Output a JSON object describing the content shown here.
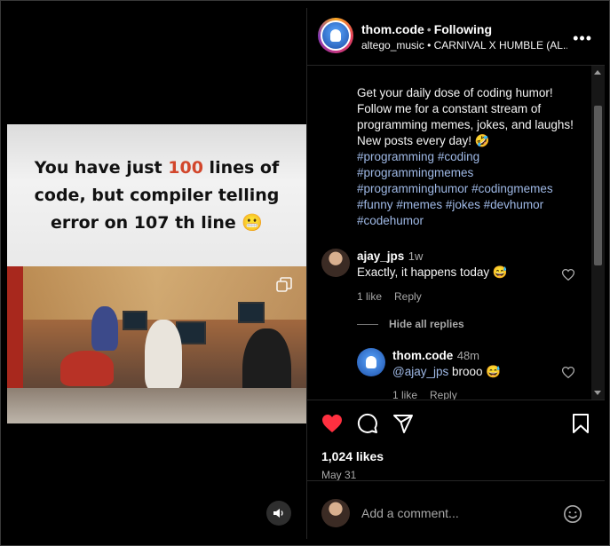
{
  "media": {
    "meme": {
      "line1_pre": "You have just ",
      "line1_num": "100",
      "line1_post": " lines of",
      "line2": "code, but compiler telling",
      "line3": "error on 107 th line 😬"
    },
    "icons": {
      "carousel": "copy-icon",
      "volume": "volume-icon"
    }
  },
  "header": {
    "username": "thom.code",
    "separator": "•",
    "follow_label": "Following",
    "music_user": "altego_music",
    "music_track": "• CARNIVAL X HUMBLE (AL...",
    "more_label": "•••"
  },
  "caption": {
    "text": "Get your daily dose of coding humor! Follow me for a constant stream of programming memes, jokes, and laughs! New posts every day! 🤣",
    "tags": [
      "#programming",
      "#coding",
      "#programmingmemes",
      "#programminghumor",
      "#codingmemes",
      "#funny",
      "#memes",
      "#jokes",
      "#devhumor",
      "#codehumor"
    ]
  },
  "comments": [
    {
      "user": "ajay_jps",
      "time": "1w",
      "text": "Exactly, it happens today 😅",
      "likes_label": "1 like",
      "reply_label": "Reply"
    }
  ],
  "replies": {
    "toggle_label": "Hide all replies",
    "items": [
      {
        "user": "thom.code",
        "time": "48m",
        "mention": "@ajay_jps",
        "text": " brooo 😅",
        "likes_label": "1 like",
        "reply_label": "Reply"
      }
    ]
  },
  "post": {
    "likes": "1,024 likes",
    "date": "May 31",
    "liked": true,
    "like_color": "#ff3040"
  },
  "composer": {
    "placeholder": "Add a comment..."
  }
}
